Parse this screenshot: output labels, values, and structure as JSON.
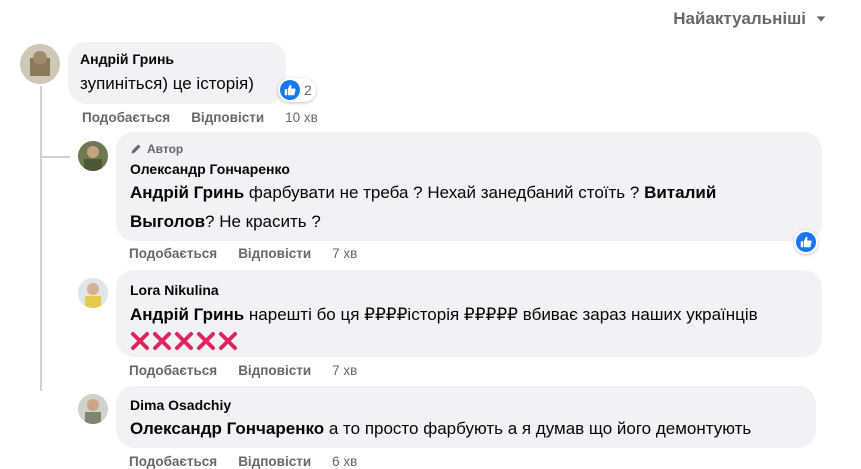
{
  "sort": {
    "label": "Найактуальніші"
  },
  "comments": [
    {
      "author": "Андрій Гринь",
      "text": "зупиніться) це історія)",
      "like_label": "Подобається",
      "reply_label": "Відповісти",
      "time": "10 хв",
      "reaction_count": "2"
    },
    {
      "badge": "Автор",
      "author": "Олександр Гончаренко",
      "m1": "Андрій Гринь",
      "t1": " фарбувати не треба ? Нехай занедбаний стоїть ? ",
      "m2": "Виталий",
      "m2b": "Выголов",
      "t2": "? Не красить ?",
      "like_label": "Подобається",
      "reply_label": "Відповісти",
      "time": "7 хв"
    },
    {
      "author": "Lora Nikulina",
      "m1": "Андрій Гринь",
      "t1": " нарешті бо ця ",
      "strike1": "₽₽₽₽",
      "t2": "історія ",
      "strike2": "₽₽₽₽₽",
      "t3": " вбиває зараз наших українців",
      "like_label": "Подобається",
      "reply_label": "Відповісти",
      "time": "7 хв"
    },
    {
      "author": "Dima Osadchiy",
      "m1": "Олександр Гончаренко",
      "t1": " а то просто фарбують а я думав що його демонтують",
      "like_label": "Подобається",
      "reply_label": "Відповісти",
      "time": "6 хв"
    }
  ],
  "colors": {
    "accent": "#1877f2",
    "bubble": "#f0f2f5",
    "muted": "#65676b",
    "x": "#e0245e"
  },
  "icons": {
    "sort": "chevron-down-icon",
    "like": "like-thumb-icon",
    "author_badge": "pencil-icon",
    "emoji": "cross-mark-icon"
  }
}
